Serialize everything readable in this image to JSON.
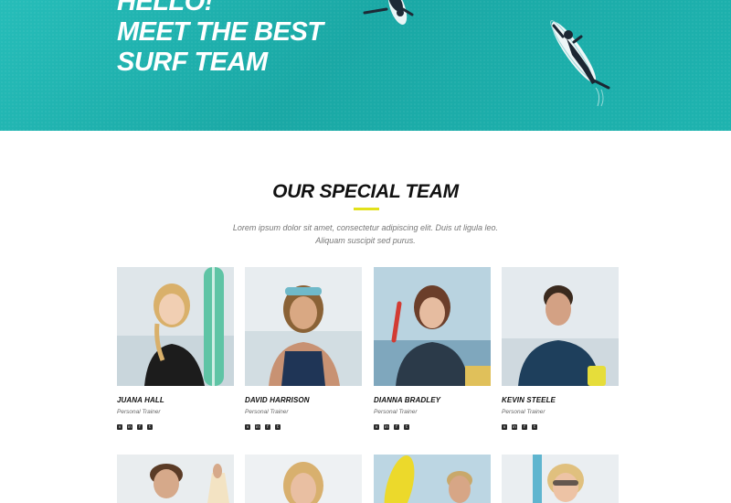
{
  "hero": {
    "line1": "HELLO!",
    "line2": "MEET THE BEST",
    "line3": "SURF TEAM"
  },
  "section": {
    "title": "OUR SPECIAL TEAM",
    "desc_line1": "Lorem ipsum dolor sit amet, consectetur adipiscing elit. Duis ut ligula leo.",
    "desc_line2": "Aliquam suscipit sed purus."
  },
  "team": [
    {
      "name": "JUANA HALL",
      "role": "Personal Trainer"
    },
    {
      "name": "DAVID HARRISON",
      "role": "Personal Trainer"
    },
    {
      "name": "DIANNA BRADLEY",
      "role": "Personal Trainer"
    },
    {
      "name": "KEVIN STEELE",
      "role": "Personal Trainer"
    }
  ],
  "social_icons": [
    "vimeo-icon",
    "linkedin-icon",
    "facebook-icon",
    "twitter-icon"
  ],
  "colors": {
    "hero_bg": "#1fb0ad",
    "accent": "#e2e11b",
    "text": "#111111"
  }
}
